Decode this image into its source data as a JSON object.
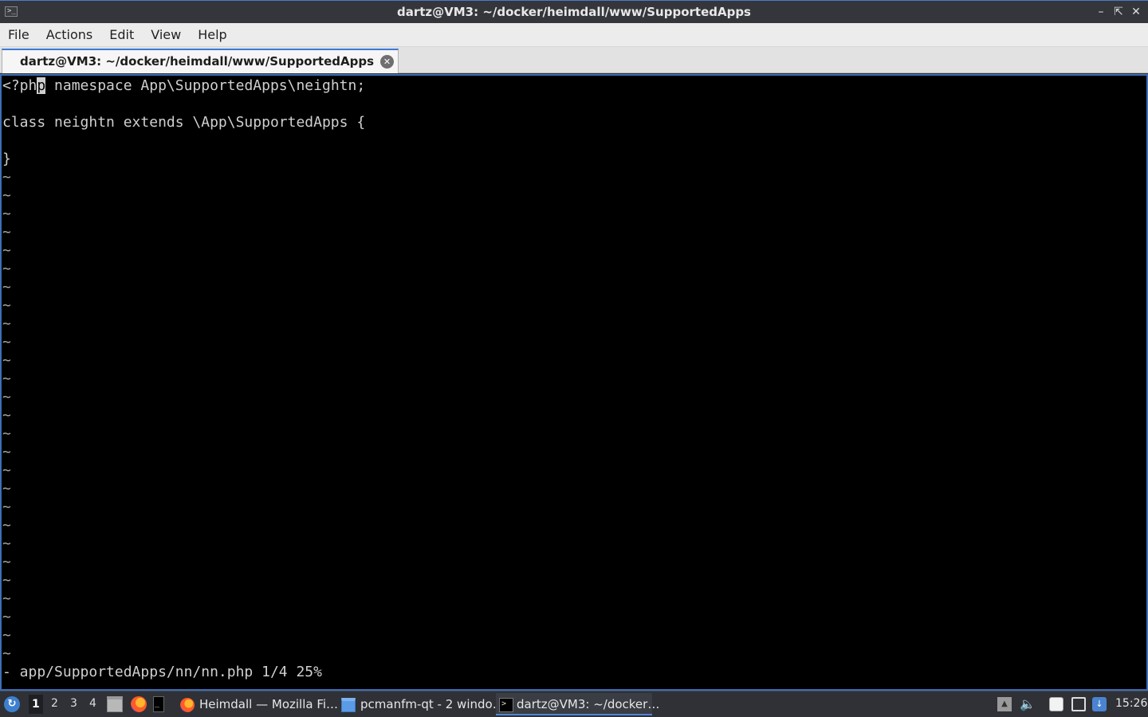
{
  "window": {
    "title": "dartz@VM3: ~/docker/heimdall/www/SupportedApps",
    "controls": [
      "minimize-icon",
      "maximize-icon",
      "close-icon"
    ]
  },
  "menubar": {
    "items": [
      "File",
      "Actions",
      "Edit",
      "View",
      "Help"
    ]
  },
  "tab": {
    "label": "dartz@VM3: ~/docker/heimdall/www/SupportedApps",
    "close_icon": "close-circle-icon"
  },
  "editor": {
    "code_lines": [
      {
        "before": "<?ph",
        "cursor": "p",
        "after": " namespace App\\SupportedApps\\neightn;"
      },
      {
        "text": ""
      },
      {
        "text": "class neightn extends \\App\\SupportedApps {"
      },
      {
        "text": ""
      },
      {
        "text": "}"
      }
    ],
    "tilde_count": 27,
    "tilde_char": "~",
    "status": "- app/SupportedApps/nn/nn.php 1/4 25%"
  },
  "taskbar": {
    "desktops": [
      "1",
      "2",
      "3",
      "4"
    ],
    "active_desktop": "1",
    "tasks": [
      {
        "label": "Heimdall — Mozilla Fi…",
        "icon": "firefox-icon"
      },
      {
        "label": "pcmanfm-qt - 2 windo…",
        "icon": "folder-icon"
      },
      {
        "label": "dartz@VM3: ~/docker…",
        "icon": "terminal-icon"
      }
    ],
    "clock": "15:26"
  }
}
